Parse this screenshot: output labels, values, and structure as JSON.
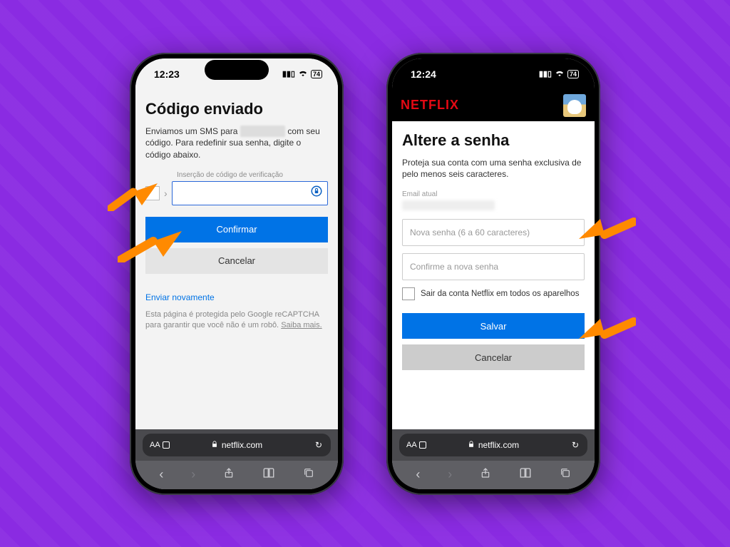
{
  "phone1": {
    "status_time": "12:23",
    "battery": "74",
    "title": "Código enviado",
    "desc_prefix": "Enviamos um SMS para ",
    "desc_masked": "xxxxxx xxxx",
    "desc_suffix": " com seu código. Para redefinir sua senha, digite o código abaixo.",
    "code_field_label": "Inserção de código de verificação",
    "confirm_label": "Confirmar",
    "cancel_label": "Cancelar",
    "resend_label": "Enviar novamente",
    "recaptcha_text": "Esta página é protegida pelo Google reCAPTCHA para garantir que você não é um robô. ",
    "recaptcha_link": "Saiba mais.",
    "url": "netflix.com"
  },
  "phone2": {
    "status_time": "12:24",
    "battery": "74",
    "brand": "NETFLIX",
    "title": "Altere a senha",
    "desc": "Proteja sua conta com uma senha exclusiva de pelo menos seis caracteres.",
    "email_label": "Email atual",
    "new_pw_placeholder": "Nova senha (6 a 60 caracteres)",
    "confirm_pw_placeholder": "Confirme a nova senha",
    "signout_label": "Sair da conta Netflix em todos os aparelhos",
    "save_label": "Salvar",
    "cancel_label": "Cancelar",
    "url": "netflix.com"
  },
  "safari": {
    "aa": "AA"
  }
}
